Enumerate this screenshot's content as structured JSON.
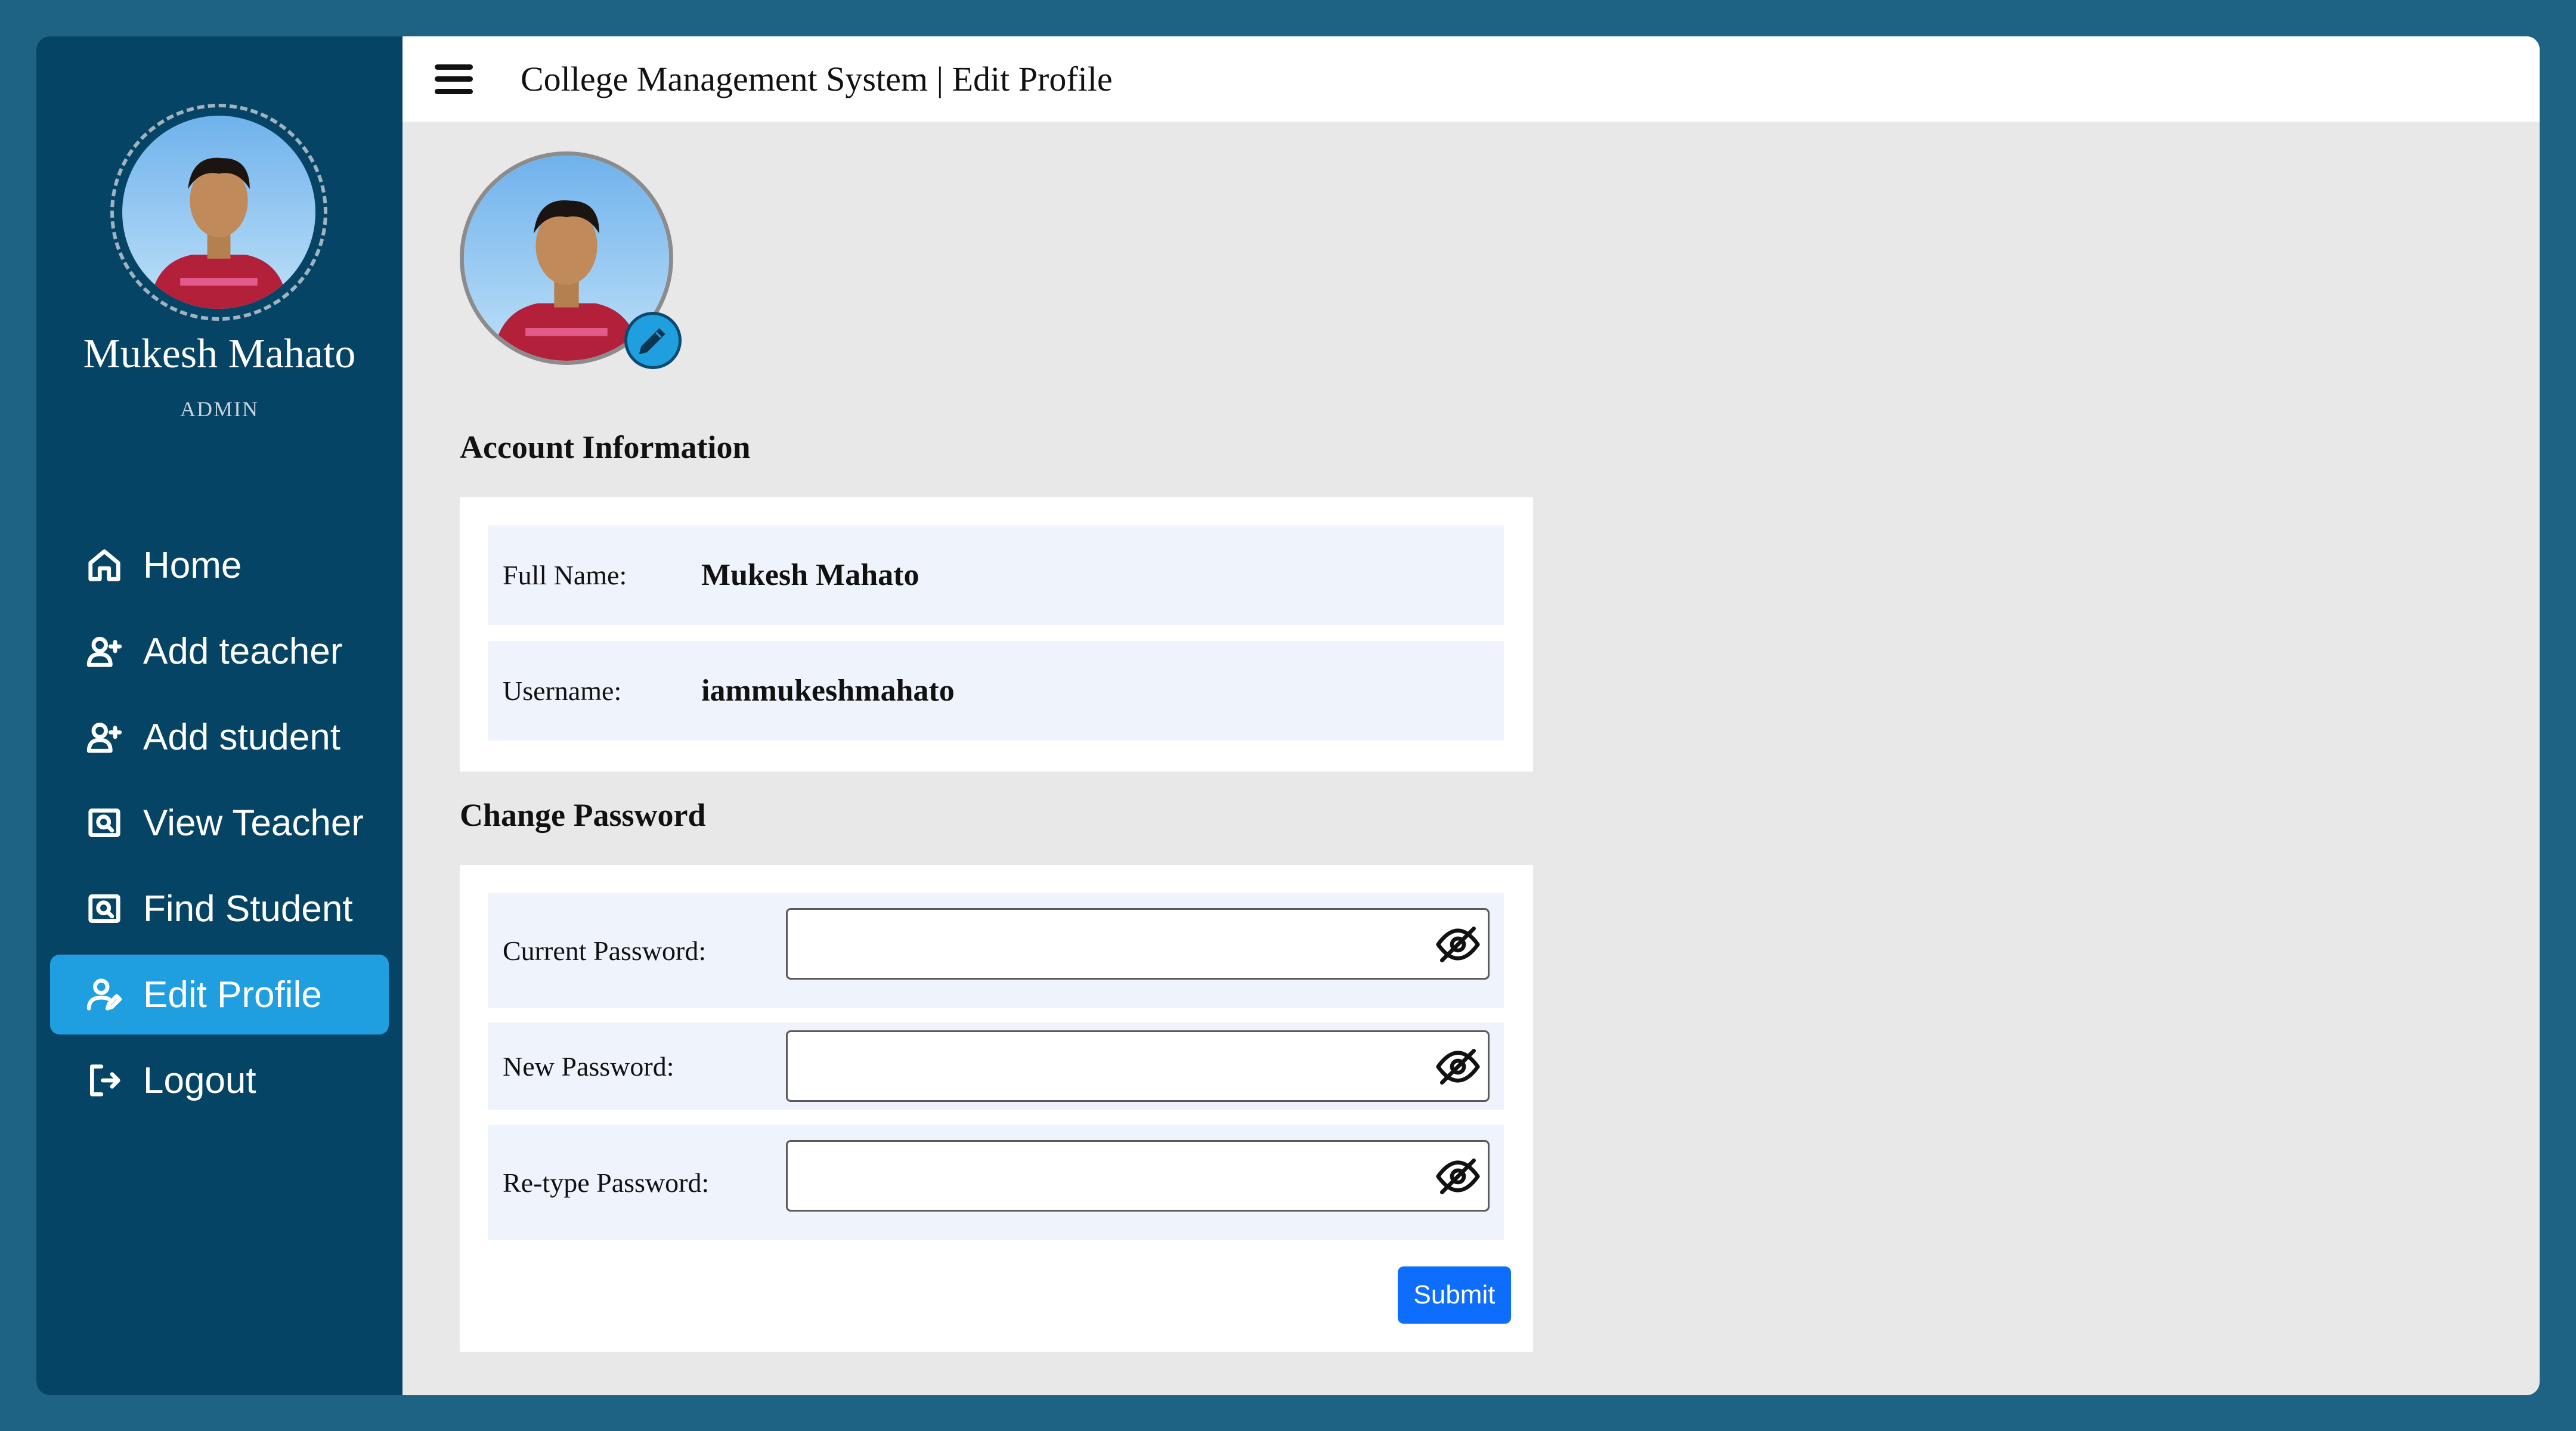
{
  "app": {
    "title": "College Management System | Edit Profile"
  },
  "user": {
    "name": "Mukesh Mahato",
    "role": "ADMIN"
  },
  "sidebar": {
    "items": [
      {
        "label": "Home",
        "icon": "home-icon",
        "active": false
      },
      {
        "label": "Add teacher",
        "icon": "add-user-icon",
        "active": false
      },
      {
        "label": "Add student",
        "icon": "add-user-icon",
        "active": false
      },
      {
        "label": "View Teacher",
        "icon": "search-card-icon",
        "active": false
      },
      {
        "label": "Find Student",
        "icon": "search-card-icon",
        "active": false
      },
      {
        "label": "Edit Profile",
        "icon": "user-edit-icon",
        "active": true
      },
      {
        "label": "Logout",
        "icon": "logout-icon",
        "active": false
      }
    ]
  },
  "account": {
    "title": "Account Information",
    "fields": [
      {
        "label": "Full Name:",
        "value": "Mukesh Mahato"
      },
      {
        "label": "Username:",
        "value": "iammukeshmahato"
      }
    ]
  },
  "password": {
    "title": "Change Password",
    "fields": [
      {
        "label": "Current Password:",
        "value": ""
      },
      {
        "label": "New Password:",
        "value": ""
      },
      {
        "label": "Re-type Password:",
        "value": ""
      }
    ],
    "submit_label": "Submit"
  },
  "colors": {
    "sidebar": "#064466",
    "active": "#1f9ee0",
    "primary_button": "#0d6efd",
    "background": "#1f6384"
  }
}
